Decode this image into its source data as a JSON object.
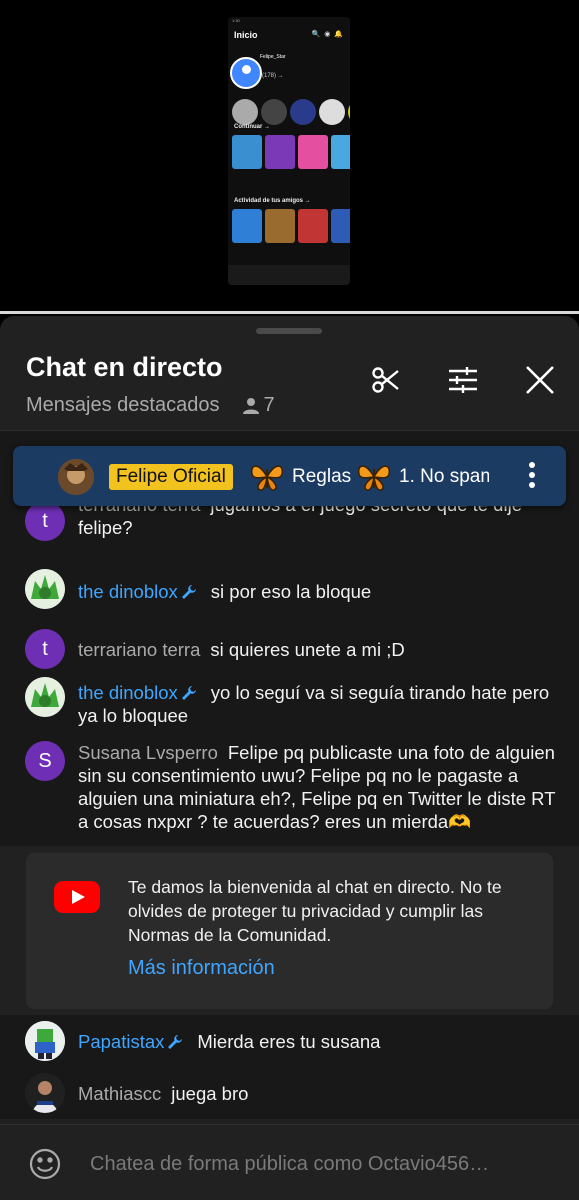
{
  "video": {
    "phone_title": "Inicio",
    "phone_username": "Felipe_Star",
    "phone_friends": "(178) →",
    "phone_continue": "Continuar →",
    "phone_activity": "Actividad de tus amigos →"
  },
  "chat": {
    "title": "Chat en directo",
    "subtitle": "Mensajes destacados",
    "viewer_count": "7"
  },
  "pinned": {
    "owner_label": "Felipe Oficial",
    "text1": "Reglas",
    "text2": "1. No spam"
  },
  "messages": [
    {
      "author": "terrariano terra",
      "text": "jugamos a el juego secreto que te dije felipe?",
      "avatar_letter": "t"
    },
    {
      "author": "the dinoblox",
      "text": "si por eso la bloque"
    },
    {
      "author": "terrariano terra",
      "text": "si quieres unete a mi ;D",
      "avatar_letter": "t"
    },
    {
      "author": "the dinoblox",
      "text": "yo lo seguí va si seguía tirando hate pero ya lo bloquee"
    },
    {
      "author": "Susana Lvsperro",
      "text": "Felipe pq publicaste una foto de alguien sin su consentimiento uwu? Felipe pq no le pagaste a alguien una miniatura eh?, Felipe pq en Twitter le diste RT a cosas nxpxr ? te acuerdas? eres un mierda🫶",
      "avatar_letter": "S"
    }
  ],
  "welcome": {
    "text": "Te damos la bienvenida al chat en directo. No te olvides de proteger tu privacidad y cumplir las Normas de la Comunidad.",
    "link": "Más información"
  },
  "bottom_messages": [
    {
      "author": "Papatistax",
      "text": "Mierda eres tu susana"
    },
    {
      "author": "Mathiascc",
      "text": "juega bro"
    }
  ],
  "input": {
    "placeholder": "Chatea de forma pública como Octavio456…"
  },
  "colors": {
    "moderator": "#3ea6ff",
    "owner_badge": "#f2c31e",
    "pinned_bg": "#1c3b63",
    "yt_red": "#ff0000"
  }
}
